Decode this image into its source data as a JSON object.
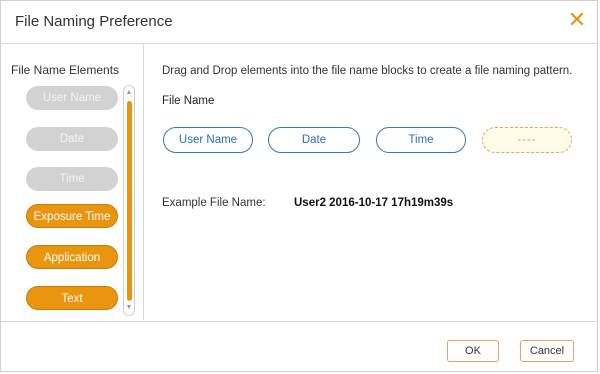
{
  "dialog": {
    "title": "File Naming Preference",
    "close_icon": "close-icon"
  },
  "left_panel": {
    "title": "File Name Elements",
    "items": [
      {
        "label": "User Name",
        "state": "disabled"
      },
      {
        "label": "Date",
        "state": "disabled"
      },
      {
        "label": "Time",
        "state": "disabled"
      },
      {
        "label": "Exposure Time",
        "state": "active"
      },
      {
        "label": "Application",
        "state": "active"
      },
      {
        "label": "Text",
        "state": "active"
      }
    ]
  },
  "right_panel": {
    "instruction": "Drag and Drop elements into the file name blocks to create a file naming pattern.",
    "file_name_label": "File Name",
    "blocks": [
      {
        "label": "User Name"
      },
      {
        "label": "Date"
      },
      {
        "label": "Time"
      },
      {
        "label": "----"
      }
    ],
    "example_label": "Example File Name:",
    "example_value": "User2 2016-10-17 17h19m39s"
  },
  "footer": {
    "ok_label": "OK",
    "cancel_label": "Cancel"
  },
  "colors": {
    "accent": "#e9950f",
    "slot_border": "#2b7cc2",
    "close": "#e8921b"
  }
}
